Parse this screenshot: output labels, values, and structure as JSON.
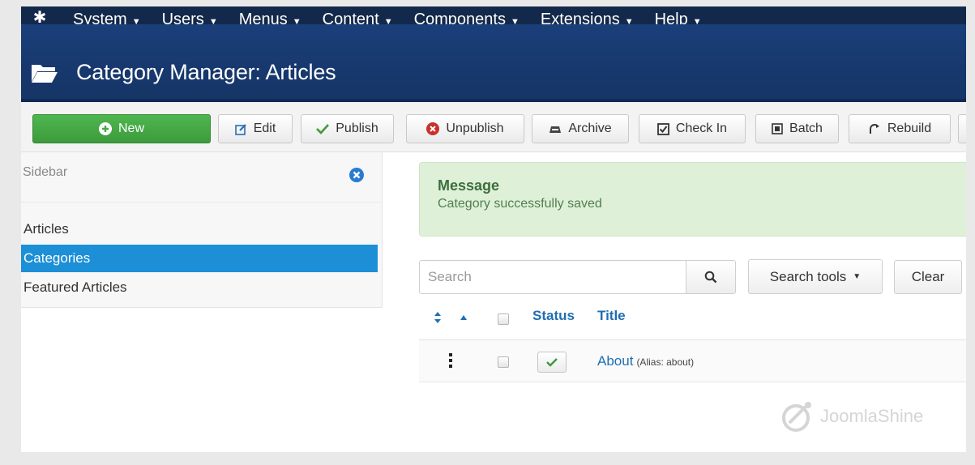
{
  "topnav": {
    "items": [
      {
        "label": "System"
      },
      {
        "label": "Users"
      },
      {
        "label": "Menus"
      },
      {
        "label": "Content"
      },
      {
        "label": "Components"
      },
      {
        "label": "Extensions"
      },
      {
        "label": "Help"
      }
    ]
  },
  "header": {
    "title": "Category Manager: Articles",
    "icon": "folder-open-icon"
  },
  "toolbar": {
    "buttons": [
      {
        "label": "New",
        "icon": "plus-circle-icon"
      },
      {
        "label": "Edit",
        "icon": "edit-icon"
      },
      {
        "label": "Publish",
        "icon": "check-icon"
      },
      {
        "label": "Unpublish",
        "icon": "x-circle-icon"
      },
      {
        "label": "Archive",
        "icon": "archive-icon"
      },
      {
        "label": "Check In",
        "icon": "checkbox-icon"
      },
      {
        "label": "Batch",
        "icon": "batch-icon"
      },
      {
        "label": "Rebuild",
        "icon": "refresh-icon"
      }
    ]
  },
  "sidebar": {
    "title": "Sidebar",
    "items": [
      {
        "label": "Articles",
        "active": false
      },
      {
        "label": "Categories",
        "active": true
      },
      {
        "label": "Featured Articles",
        "active": false
      }
    ]
  },
  "message": {
    "title": "Message",
    "text": "Category successfully saved"
  },
  "filters": {
    "search_placeholder": "Search",
    "search_tools_label": "Search tools",
    "clear_label": "Clear"
  },
  "table": {
    "headers": {
      "status": "Status",
      "title": "Title"
    },
    "rows": [
      {
        "title": "About",
        "alias": "(Alias: about)",
        "published": true
      }
    ]
  },
  "watermark": {
    "text": "JoomlaShine"
  },
  "colors": {
    "nav": "#13294b",
    "header": "#17386d",
    "new_button": "#46a946",
    "active_sidebar": "#1c8fd7",
    "alert_bg": "#dff0d8",
    "link": "#1f6fb2"
  }
}
